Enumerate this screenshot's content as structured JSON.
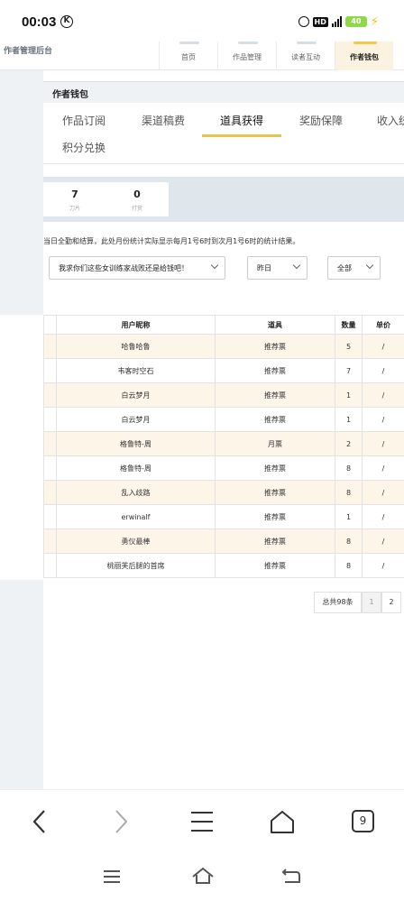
{
  "status": {
    "time": "00:03",
    "k_badge": "K",
    "hd": "HD",
    "battery": "40"
  },
  "site": {
    "title": "作者管理后台",
    "tabs": [
      "首页",
      "作品管理",
      "读者互动",
      "作者钱包"
    ]
  },
  "wallet": {
    "header": "作者钱包",
    "tabs": [
      "作品订阅",
      "渠道稿费",
      "道具获得",
      "奖励保障",
      "收入统",
      "积分兑换"
    ],
    "active_tab": "道具获得",
    "stats": [
      {
        "value": "7",
        "label": "刀片"
      },
      {
        "value": "0",
        "label": "打赏"
      }
    ],
    "notice": "当日全勤和结算，此处月份统计实际显示每月1号6时到次月1号6时的统计结果。",
    "filters": {
      "book": "我求你们这些女训练家战败还是给钱吧！",
      "date": "昨日",
      "type": "全部"
    }
  },
  "table": {
    "headers": [
      "用户昵称",
      "道具",
      "数量",
      "单价"
    ],
    "rows": [
      {
        "nick": "哈鲁哈鲁",
        "item": "推荐票",
        "qty": "5",
        "price": "/"
      },
      {
        "nick": "韦客时空石",
        "item": "推荐票",
        "qty": "7",
        "price": "/"
      },
      {
        "nick": "白云梦月",
        "item": "推荐票",
        "qty": "1",
        "price": "/"
      },
      {
        "nick": "白云梦月",
        "item": "推荐票",
        "qty": "1",
        "price": "/"
      },
      {
        "nick": "格鲁特-周",
        "item": "月票",
        "qty": "2",
        "price": "/"
      },
      {
        "nick": "格鲁特-周",
        "item": "推荐票",
        "qty": "8",
        "price": "/"
      },
      {
        "nick": "乱入歧路",
        "item": "推荐票",
        "qty": "8",
        "price": "/"
      },
      {
        "nick": "erwinalf",
        "item": "推荐票",
        "qty": "1",
        "price": "/"
      },
      {
        "nick": "勇仪最棒",
        "item": "推荐票",
        "qty": "8",
        "price": "/"
      },
      {
        "nick": "桃丽芙后腿的首席",
        "item": "推荐票",
        "qty": "8",
        "price": "/"
      }
    ]
  },
  "pagination": {
    "total": "总共98条",
    "pages": [
      "1",
      "2"
    ]
  },
  "browser": {
    "tab_count": "9"
  }
}
